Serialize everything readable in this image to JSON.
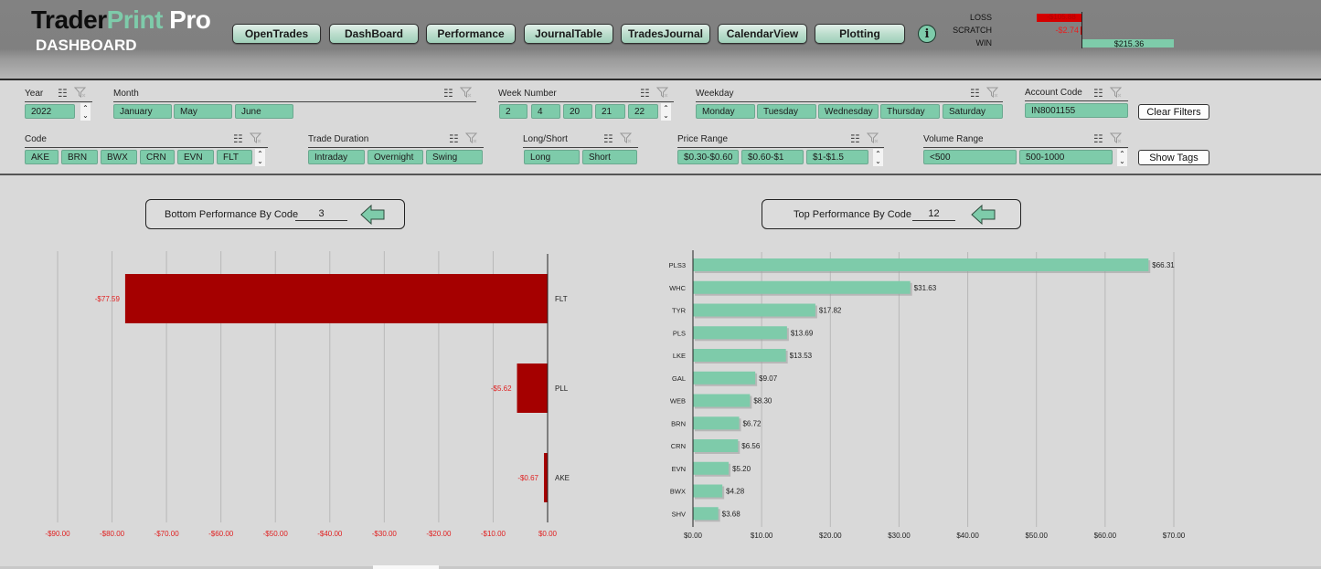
{
  "header": {
    "brand_part1": "Trader",
    "brand_part2": "Print",
    "brand_part3": "Pro",
    "subtitle": "DASHBOARD",
    "nav": [
      {
        "label": "OpenTrades"
      },
      {
        "label": "DashBoard"
      },
      {
        "label": "Performance"
      },
      {
        "label": "JournalTable"
      },
      {
        "label": "TradesJournal"
      },
      {
        "label": "CalendarView"
      },
      {
        "label": "Plotting"
      }
    ],
    "info_label": "i",
    "summary": {
      "loss_label": "LOSS",
      "scratch_label": "SCRATCH",
      "win_label": "WIN",
      "loss_value": "-$105.88",
      "scratch_value": "-$2.74",
      "win_value": "$215.36",
      "loss_amount": -105.88,
      "scratch_amount": -2.74,
      "win_amount": 215.36,
      "loss_color": "#d40000",
      "win_color": "#7ecbaa"
    }
  },
  "filters": {
    "year": {
      "label": "Year",
      "items": [
        "2022"
      ]
    },
    "month": {
      "label": "Month",
      "items": [
        "January",
        "May",
        "June"
      ]
    },
    "week": {
      "label": "Week Number",
      "items": [
        "2",
        "4",
        "20",
        "21",
        "22"
      ]
    },
    "weekday": {
      "label": "Weekday",
      "items": [
        "Monday",
        "Tuesday",
        "Wednesday",
        "Thursday",
        "Saturday"
      ]
    },
    "account": {
      "label": "Account Code",
      "items": [
        "IN8001155"
      ]
    },
    "code": {
      "label": "Code",
      "items": [
        "AKE",
        "BRN",
        "BWX",
        "CRN",
        "EVN",
        "FLT"
      ]
    },
    "duration": {
      "label": "Trade Duration",
      "items": [
        "Intraday",
        "Overnight",
        "Swing"
      ]
    },
    "longshort": {
      "label": "Long/Short",
      "items": [
        "Long",
        "Short"
      ]
    },
    "price": {
      "label": "Price Range",
      "items": [
        "$0.30-$0.60",
        "$0.60-$1",
        "$1-$1.5"
      ]
    },
    "volume": {
      "label": "Volume Range",
      "items": [
        "<500",
        "500-1000"
      ]
    },
    "clear_label": "Clear Filters",
    "tags_label": "Show Tags"
  },
  "bottom_selector": {
    "label": "Bottom Performance By Code",
    "value": "3"
  },
  "top_selector": {
    "label": "Top Performance By Code",
    "value": "12"
  },
  "colors": {
    "accent": "#7ecbaa",
    "loss": "#a50000",
    "loss_text": "#e02020"
  },
  "chart_data": [
    {
      "type": "bar",
      "orientation": "horizontal",
      "title": "Bottom Performance By Code",
      "categories": [
        "FLT",
        "PLL",
        "AKE"
      ],
      "values": [
        -77.59,
        -5.62,
        -0.67
      ],
      "value_labels": [
        "-$77.59",
        "-$5.62",
        "-$0.67"
      ],
      "xlim": [
        -90,
        0
      ],
      "xticks": [
        -90,
        -80,
        -70,
        -60,
        -50,
        -40,
        -30,
        -20,
        -10,
        0
      ],
      "xtick_labels": [
        "-$90.00",
        "-$80.00",
        "-$70.00",
        "-$60.00",
        "-$50.00",
        "-$40.00",
        "-$30.00",
        "-$20.00",
        "-$10.00",
        "$0.00"
      ],
      "grid": true,
      "color": "#a50000"
    },
    {
      "type": "bar",
      "orientation": "horizontal",
      "title": "Top Performance By Code",
      "categories": [
        "PLS3",
        "WHC",
        "TYR",
        "PLS",
        "LKE",
        "GAL",
        "WEB",
        "BRN",
        "CRN",
        "EVN",
        "BWX",
        "SHV"
      ],
      "values": [
        66.31,
        31.63,
        17.82,
        13.69,
        13.53,
        9.07,
        8.3,
        6.72,
        6.56,
        5.2,
        4.28,
        3.68
      ],
      "value_labels": [
        "$66.31",
        "$31.63",
        "$17.82",
        "$13.69",
        "$13.53",
        "$9.07",
        "$8.30",
        "$6.72",
        "$6.56",
        "$5.20",
        "$4.28",
        "$3.68"
      ],
      "xlim": [
        0,
        70
      ],
      "xticks": [
        0,
        10,
        20,
        30,
        40,
        50,
        60,
        70
      ],
      "xtick_labels": [
        "$0.00",
        "$10.00",
        "$20.00",
        "$30.00",
        "$40.00",
        "$50.00",
        "$60.00",
        "$70.00"
      ],
      "grid": true,
      "color": "#7ecbaa"
    }
  ]
}
